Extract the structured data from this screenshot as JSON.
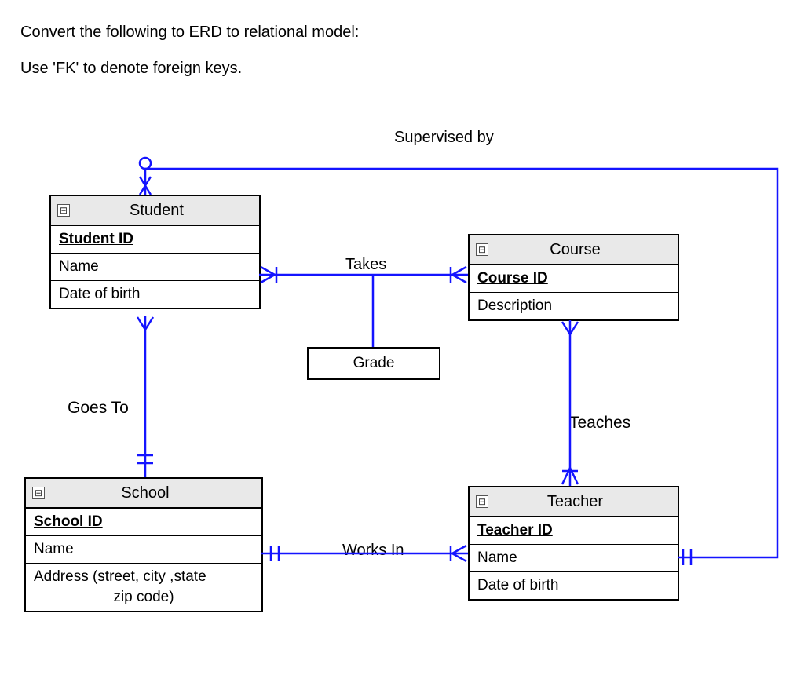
{
  "prompt": {
    "line1": "Convert the following to ERD to relational model:",
    "line2": "Use 'FK' to denote foreign keys."
  },
  "entities": {
    "student": {
      "title": "Student",
      "attrs": [
        "Student ID",
        "Name",
        "Date of birth"
      ],
      "pk_index": 0
    },
    "course": {
      "title": "Course",
      "attrs": [
        "Course ID",
        "Description"
      ],
      "pk_index": 0
    },
    "school": {
      "title": "School",
      "attrs": [
        "School ID",
        "Name",
        "Address (street, city ,state"
      ],
      "attr_sub": "zip code)",
      "pk_index": 0
    },
    "teacher": {
      "title": "Teacher",
      "attrs": [
        "Teacher ID",
        "Name",
        "Date of birth"
      ],
      "pk_index": 0
    }
  },
  "relationships": {
    "supervised_by": "Supervised by",
    "takes": "Takes",
    "goes_to": "Goes To",
    "teaches": "Teaches",
    "works_in": "Works In"
  },
  "assoc": {
    "grade": "Grade"
  },
  "icons": {
    "collapse": "⊟"
  }
}
